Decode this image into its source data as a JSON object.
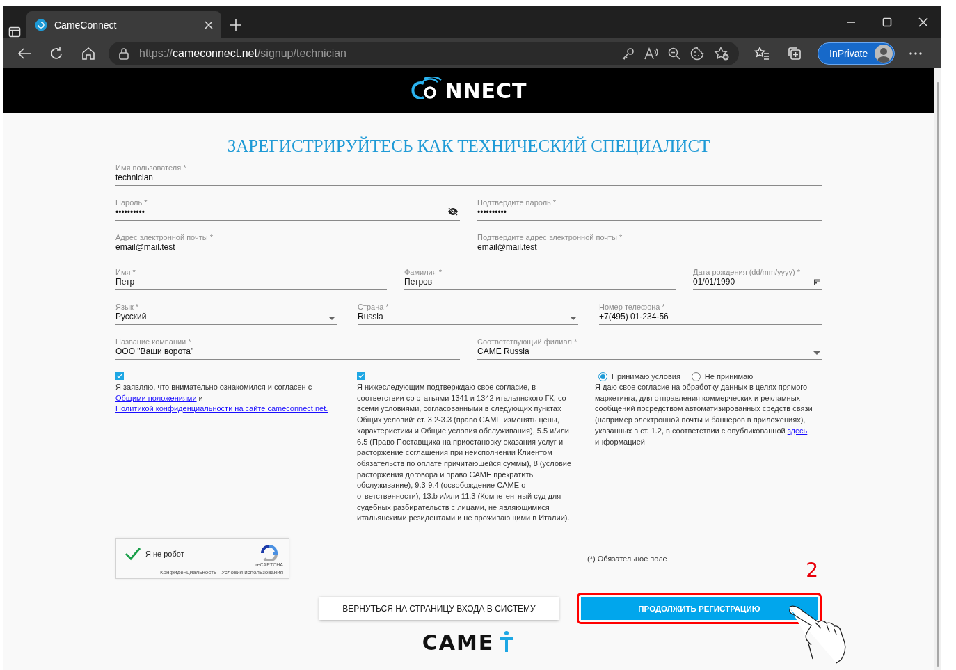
{
  "browser": {
    "tab": {
      "title": "CameConnect",
      "selected": true
    },
    "address": {
      "scheme": "https://",
      "host": "cameconnect.net",
      "path": "/signup/technician"
    },
    "profile_button": "InPrivate"
  },
  "header": {
    "logo_text": "NNECT"
  },
  "title": "ЗАРЕГИСТРИРУЙТЕСЬ КАК ТЕХНИЧЕСКИЙ СПЕЦИАЛИСТ",
  "form_rows": [
    [
      {
        "kind": "text",
        "label": "Имя пользователя *",
        "value": "technician"
      }
    ],
    [
      {
        "kind": "password",
        "label": "Пароль *",
        "value": "••••••••••",
        "visibility_toggle": true
      },
      {
        "kind": "password",
        "label": "Подтвердите пароль *",
        "value": "••••••••••",
        "visibility_toggle": false
      }
    ],
    [
      {
        "kind": "text",
        "label": "Адрес электронной почты *",
        "value": "email@mail.test"
      },
      {
        "kind": "text",
        "label": "Подтвердите адрес электронной почты *",
        "value": "email@mail.test"
      }
    ],
    [
      {
        "kind": "text",
        "label": "Имя *",
        "value": "Петр"
      },
      {
        "kind": "text",
        "label": "Фамилия *",
        "value": "Петров"
      },
      {
        "kind": "date",
        "label": "Дата рождения (dd/mm/yyyy) *",
        "value": "01/01/1990"
      }
    ],
    [
      {
        "kind": "select",
        "label": "Язык *",
        "value": "Русский"
      },
      {
        "kind": "select",
        "label": "Страна *",
        "value": "Russia"
      },
      {
        "kind": "text",
        "label": "Номер телефона *",
        "value": "+7(495) 01-234-56"
      }
    ],
    [
      {
        "kind": "text",
        "label": "Название компании *",
        "value": "ООО \"Ваши ворота\""
      },
      {
        "kind": "select",
        "label": "Соответствующий филиал *",
        "value": "CAME Russia"
      }
    ]
  ],
  "consents": [
    {
      "kind": "checkbox",
      "checked": true,
      "text": [
        {
          "text": "Я заявляю, что внимательно ознакомился и согласен с "
        },
        {
          "text": "Общими положениями",
          "link": true
        },
        {
          "text": " и "
        },
        {
          "text": "Политикой конфиденциальности на сайте cameconnect.net.",
          "link": true
        }
      ]
    },
    {
      "kind": "checkbox",
      "checked": true,
      "text": [
        {
          "text": "Я нижеследующим подтверждаю свое согласие, в соответствии со статьями 1341 и 1342 итальянского ГК, со всеми условиями, согласованными в следующих пунктах Общих условий: ст. 3.2-3.3 (право CAME изменять цены, характеристики и Общие условия обслуживания), 5.5 и/или 6.5 (Право Поставщика на приостановку оказания услуг и расторжение соглашения при неисполнении Клиентом обязательств по оплате причитающейся суммы), 8 (условие расторжения договора и право CAME прекратить обслуживание), 9.3-9.4 (освобождение CAME от ответственности), 13.b и/или 11.3 (Компетентный суд для судебных разбирательств с лицами, не являющимися итальянскими резидентами и не проживающими в Италии)."
        }
      ]
    },
    {
      "kind": "radio",
      "options": [
        {
          "label": "Принимаю условия",
          "selected": true
        },
        {
          "label": "Не принимаю",
          "selected": false
        }
      ],
      "text": [
        {
          "text": "Я даю свое согласие на обработку данных в целях прямого маркетинга, для отправления коммерческих и рекламных сообщений посредством автоматизированных средств связи (например электронной почты и баннеров в приложениях), указанных в ст. 1.2, в соответствии с опубликованной "
        },
        {
          "text": "здесь",
          "link": true
        },
        {
          "text": " информацией"
        }
      ]
    }
  ],
  "captcha": {
    "checked": true,
    "label": "Я не робот",
    "brand": "reCAPTCHA",
    "links": "Конфиденциальность - Условия использования"
  },
  "required_note": "(*) Обязательное поле",
  "buttons": [
    {
      "kind": "secondary",
      "label": "ВЕРНУТЬСЯ НА СТРАНИЦУ ВХОДА В СИСТЕМУ",
      "highlighted": false
    },
    {
      "kind": "primary",
      "label": "ПРОДОЛЖИТЬ РЕГИСТРАЦИЮ",
      "highlighted": true
    }
  ],
  "annotation": {
    "label": "2"
  },
  "footer": {
    "logo_text": "CAME"
  }
}
